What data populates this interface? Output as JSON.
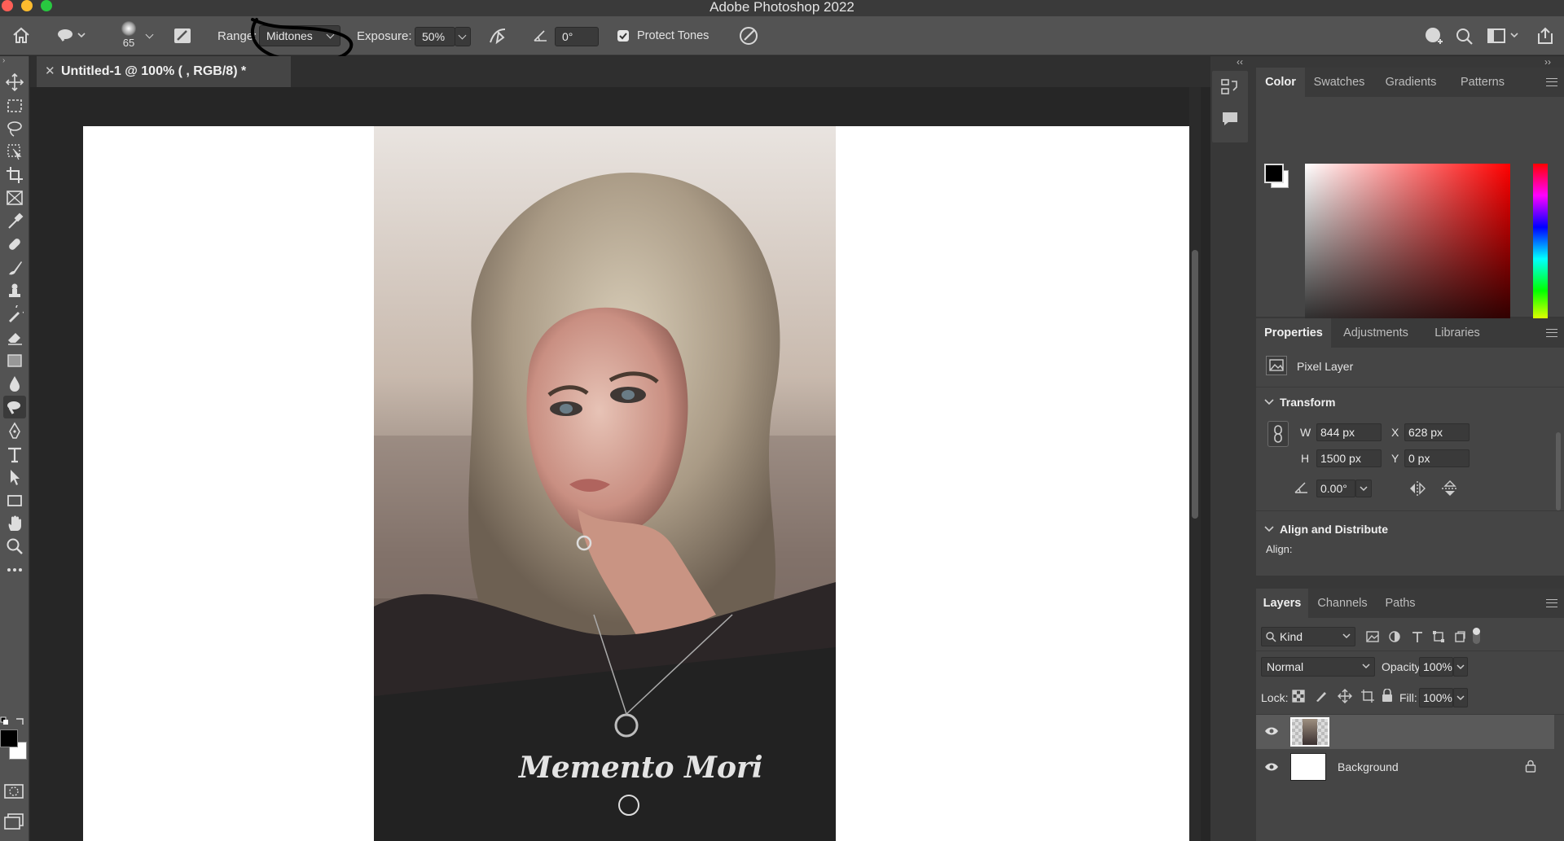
{
  "app": {
    "title": "Adobe Photoshop 2022"
  },
  "window_controls": {
    "close_color": "#ff5f57",
    "minimize_color": "#febc2e",
    "zoom_color": "#28c840"
  },
  "options_bar": {
    "brush_size": "65",
    "range_label": "Range:",
    "range_value": "Midtones",
    "exposure_label": "Exposure:",
    "exposure_value": "50%",
    "angle_value": "0°",
    "protect_tones_label": "Protect Tones",
    "protect_tones_checked": true
  },
  "document": {
    "tab_title": "Untitled-1 @ 100% ( , RGB/8) *",
    "photo_caption": "Memento Mori"
  },
  "toolbar": {
    "tools": [
      "move-tool",
      "rectangular-marquee-tool",
      "lasso-tool",
      "object-selection-tool",
      "crop-tool",
      "frame-tool",
      "eyedropper-tool",
      "spot-healing-brush-tool",
      "brush-tool",
      "clone-stamp-tool",
      "history-brush-tool",
      "eraser-tool",
      "gradient-tool",
      "blur-tool",
      "dodge-tool",
      "pen-tool",
      "type-tool",
      "path-selection-tool",
      "rectangle-tool",
      "hand-tool",
      "zoom-tool",
      "edit-toolbar"
    ],
    "active_tool": "dodge-tool",
    "foreground_color": "#000000",
    "background_color": "#ffffff"
  },
  "color_panel": {
    "tabs": [
      "Color",
      "Swatches",
      "Gradients",
      "Patterns"
    ],
    "active_tab": "Color",
    "hue_color": "#ff0000"
  },
  "properties_panel": {
    "tabs": [
      "Properties",
      "Adjustments",
      "Libraries"
    ],
    "active_tab": "Properties",
    "layer_type": "Pixel Layer",
    "transform_label": "Transform",
    "w_label": "W",
    "w_value": "844 px",
    "h_label": "H",
    "h_value": "1500 px",
    "x_label": "X",
    "x_value": "628 px",
    "y_label": "Y",
    "y_value": "0 px",
    "angle_value": "0.00°",
    "align_section": "Align and Distribute",
    "align_label": "Align:"
  },
  "layers_panel": {
    "tabs": [
      "Layers",
      "Channels",
      "Paths"
    ],
    "active_tab": "Layers",
    "filter_kind": "Kind",
    "blend_mode": "Normal",
    "opacity_label": "Opacity:",
    "opacity_value": "100%",
    "lock_label": "Lock:",
    "fill_label": "Fill:",
    "fill_value": "100%",
    "layers": [
      {
        "name": "",
        "visible": true,
        "selected": true,
        "locked": false
      },
      {
        "name": "Background",
        "visible": true,
        "selected": false,
        "locked": true
      }
    ]
  }
}
